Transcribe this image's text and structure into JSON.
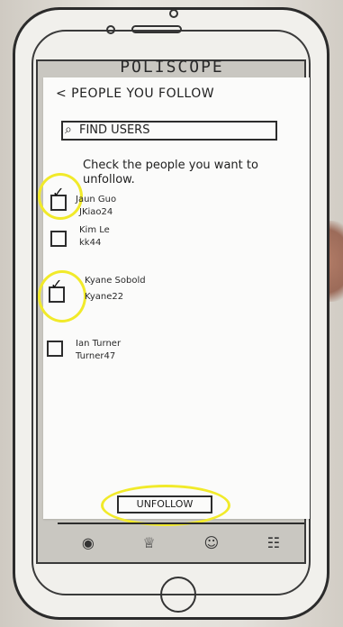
{
  "app": {
    "title": "POLISCOPE"
  },
  "header": {
    "back_label": "< PEOPLE YOU FOLLOW"
  },
  "search": {
    "placeholder": "FIND USERS",
    "value": ""
  },
  "instructions": {
    "text": "Check the people you want to unfollow."
  },
  "users": [
    {
      "name": "Jaun Guo",
      "handle": "JKiao24",
      "checked": true
    },
    {
      "name": "Kim Le",
      "handle": "kk44",
      "checked": false
    },
    {
      "name": "Kyane Sobold",
      "handle": "Kyane22",
      "checked": true
    },
    {
      "name": "Ian Turner",
      "handle": "Turner47",
      "checked": false
    }
  ],
  "actions": {
    "unfollow_label": "UNFOLLOW"
  },
  "tabbar": {
    "icons": [
      "camera-icon",
      "trophy-icon",
      "person-icon",
      "group-icon"
    ]
  },
  "highlight_color": "#f1ea2a"
}
